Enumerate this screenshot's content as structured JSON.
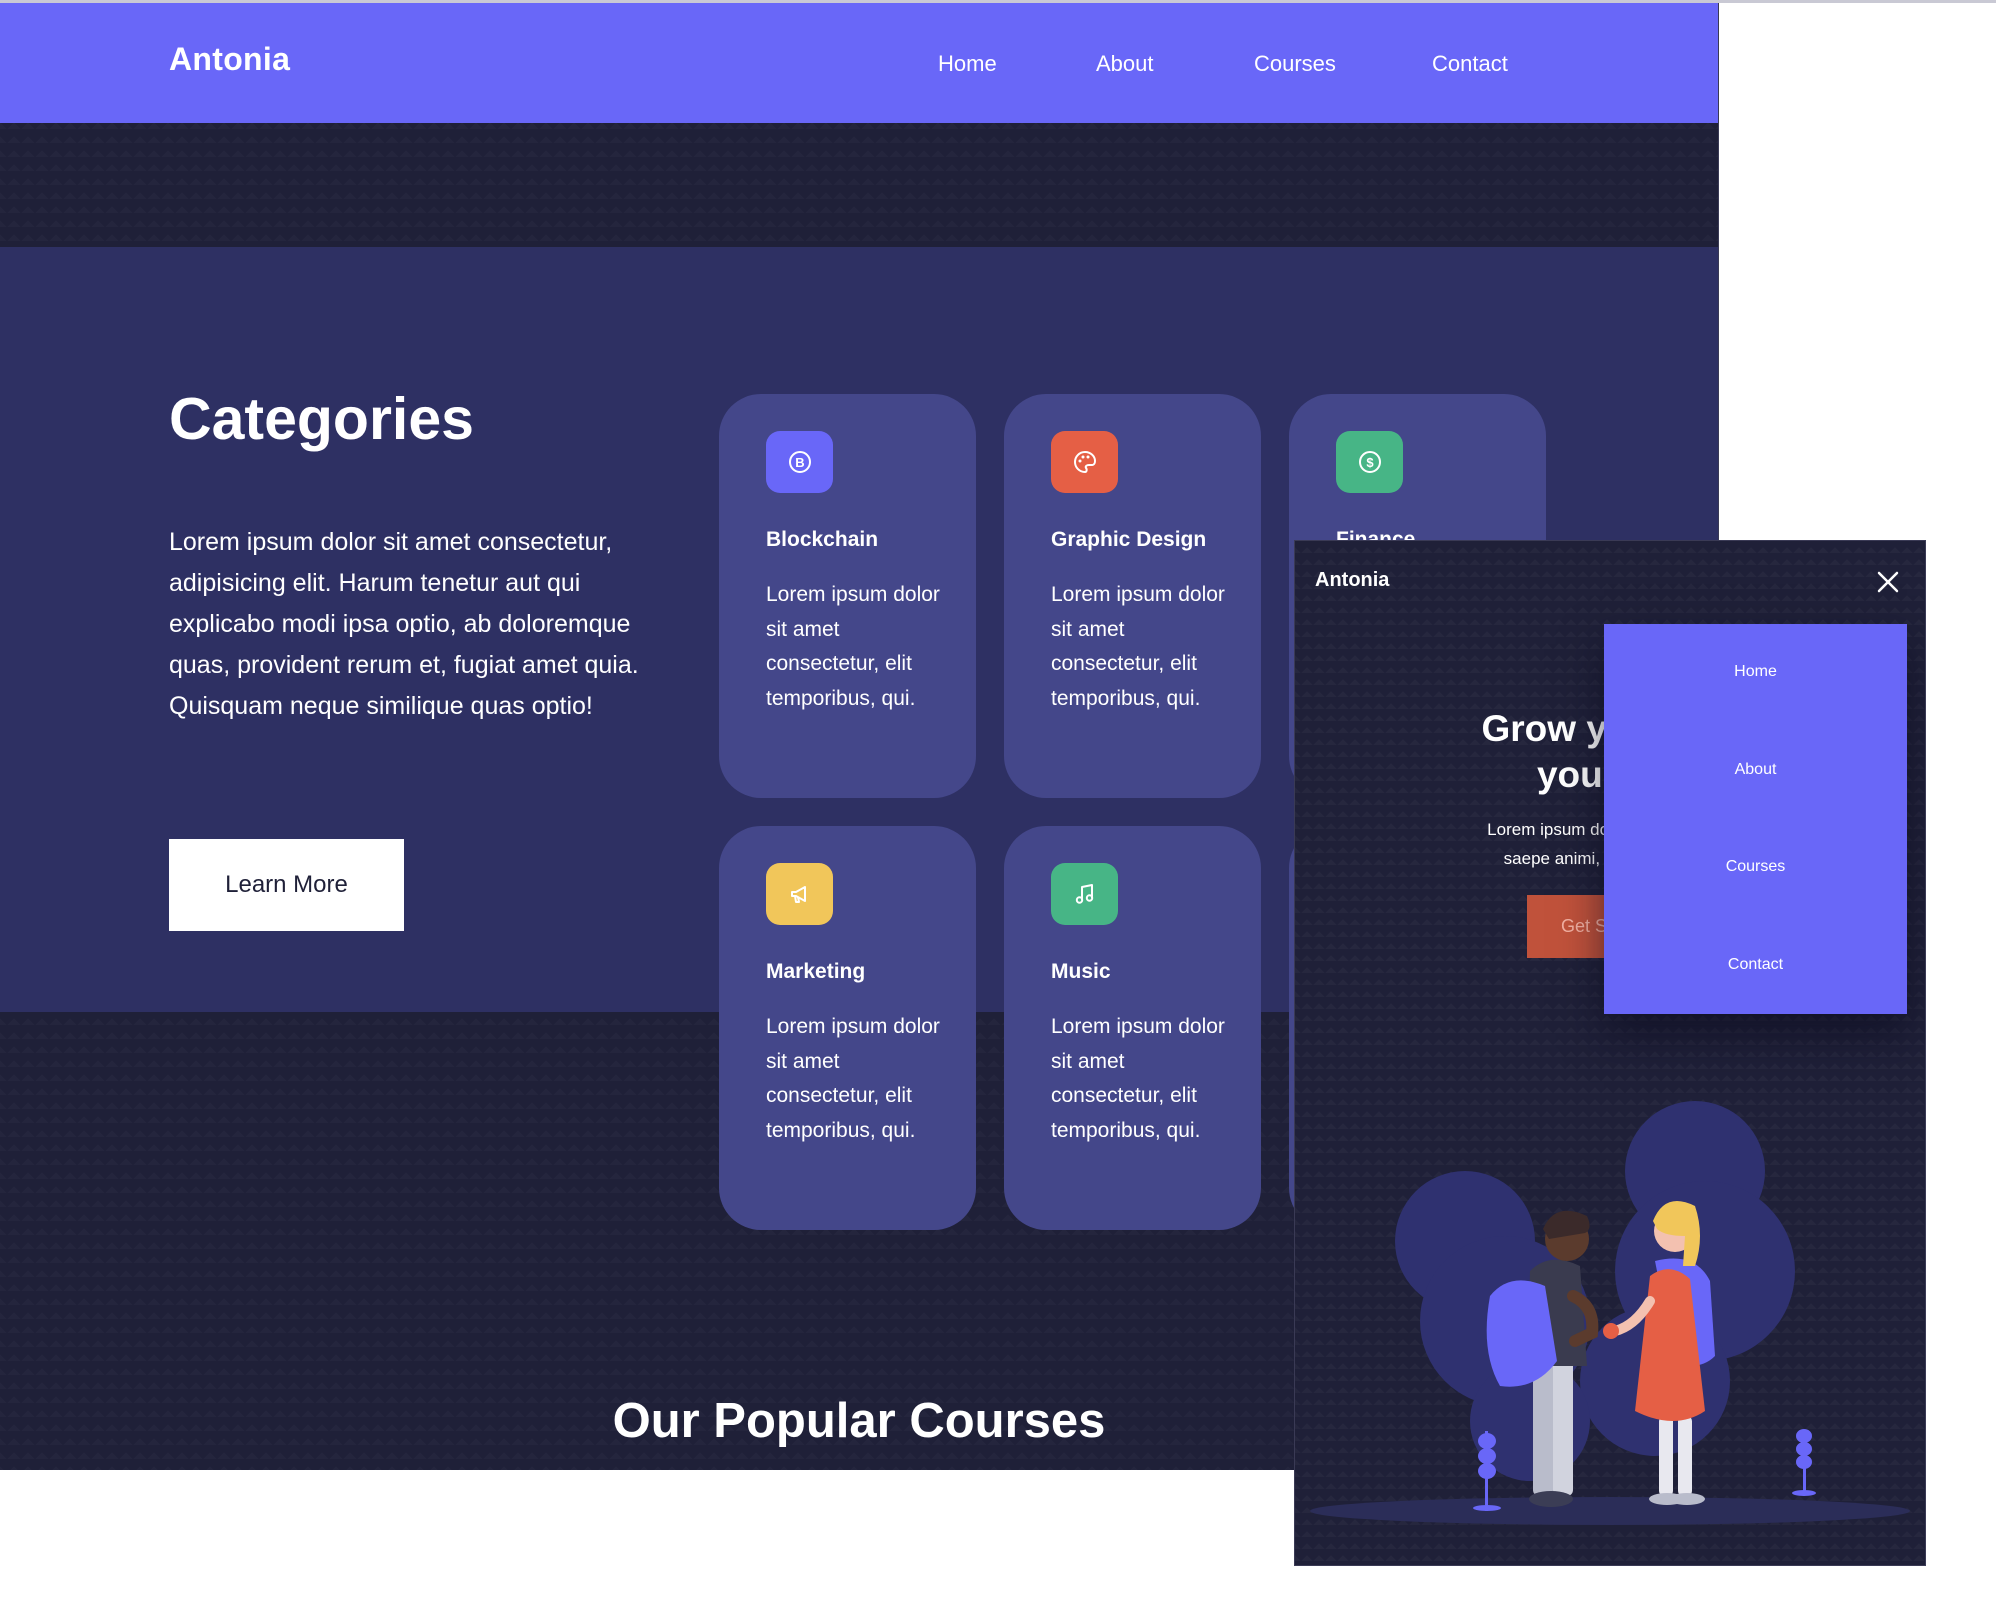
{
  "desktop": {
    "brand": "Antonia",
    "nav": [
      "Home",
      "About",
      "Courses",
      "Contact"
    ],
    "categories": {
      "title": "Categories",
      "description": "Lorem ipsum dolor sit amet consectetur, adipisicing elit. Harum tenetur aut qui explicabo modi ipsa optio, ab doloremque quas, provident rerum et, fugiat amet quia. Quisquam neque similique quas optio!",
      "button": "Learn More"
    },
    "cards": [
      {
        "title": "Blockchain",
        "text": "Lorem ipsum dolor sit amet consectetur, elit temporibus, qui.",
        "icon": "bitcoin-icon",
        "color": "#6967f8"
      },
      {
        "title": "Graphic Design",
        "text": "Lorem ipsum dolor sit amet consectetur, elit temporibus, qui.",
        "icon": "palette-icon",
        "color": "#e55f45"
      },
      {
        "title": "Finance",
        "icon": "dollar-icon",
        "color": "#47b586"
      },
      {
        "title": "Marketing",
        "text": "Lorem ipsum dolor sit amet consectetur, elit temporibus, qui.",
        "icon": "megaphone-icon",
        "color": "#f1c65a"
      },
      {
        "title": "Music",
        "text": "Lorem ipsum dolor sit amet consectetur, elit temporibus, qui.",
        "icon": "music-icon",
        "color": "#47b586"
      }
    ],
    "popular_title": "Our Popular Courses"
  },
  "mobile": {
    "brand": "Antonia",
    "menu": [
      "Home",
      "About",
      "Courses",
      "Contact"
    ],
    "hero_title_1": "Grow your skil",
    "hero_title_2": "your car",
    "hero_text_1": "Lorem ipsum dolor sit amet cons",
    "hero_text_2": "saepe animi, ad quis et atqu",
    "button": "Get S"
  },
  "colors": {
    "accent": "#6967f8",
    "background": "#1f2038",
    "band": "#2e3063",
    "card": "#44478a",
    "cta": "#c0523b"
  }
}
